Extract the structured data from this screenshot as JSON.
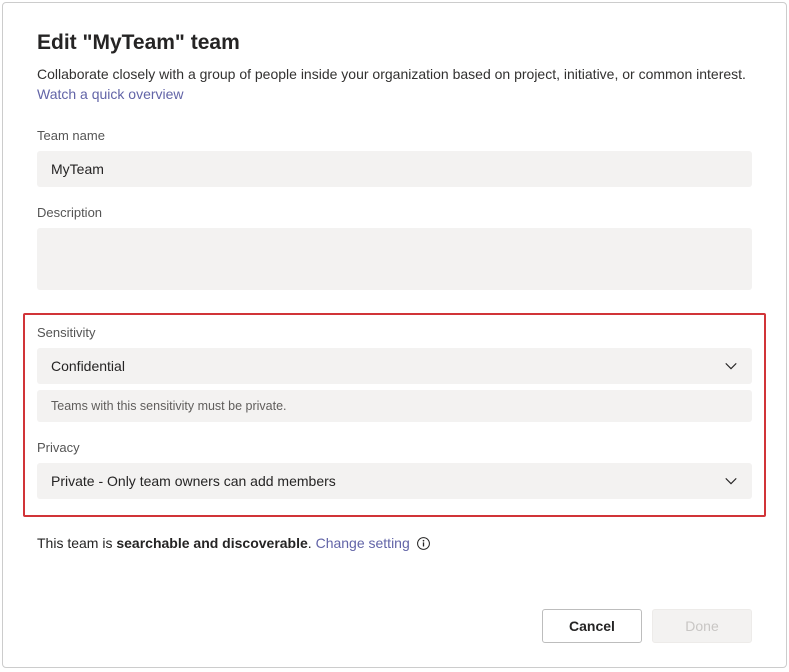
{
  "dialog": {
    "title": "Edit \"MyTeam\" team",
    "subtitle_before": "Collaborate closely with a group of people inside your organization based on project, initiative, or common interest. ",
    "subtitle_link": "Watch a quick overview"
  },
  "fields": {
    "team_name": {
      "label": "Team name",
      "value": "MyTeam"
    },
    "description": {
      "label": "Description",
      "value": ""
    },
    "sensitivity": {
      "label": "Sensitivity",
      "value": "Confidential",
      "hint": "Teams with this sensitivity must be private."
    },
    "privacy": {
      "label": "Privacy",
      "value": "Private - Only team owners can add members"
    }
  },
  "discover": {
    "prefix": "This team is ",
    "bold": "searchable and discoverable",
    "suffix": ". ",
    "change_link": "Change setting"
  },
  "footer": {
    "cancel": "Cancel",
    "done": "Done"
  }
}
